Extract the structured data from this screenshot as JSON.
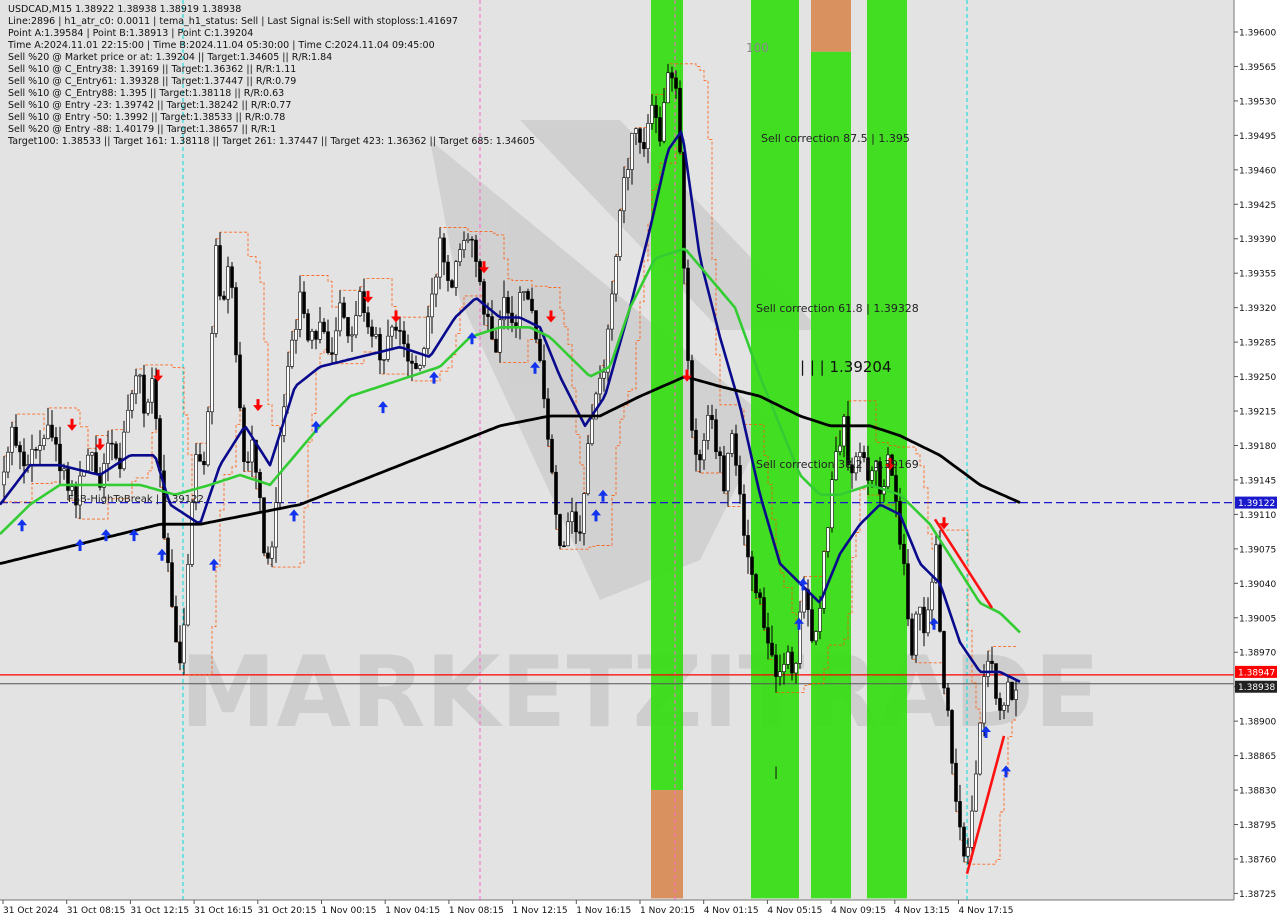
{
  "header": {
    "title": "USDCAD,M15  1.38922 1.38938 1.38919 1.38938",
    "lines": [
      "Line:2896 | h1_atr_c0: 0.0011 | tema_h1_status: Sell | Last Signal is:Sell with stoploss:1.41697",
      "Point A:1.39584 | Point B:1.38913 | Point C:1.39204",
      "Time A:2024.11.01 22:15:00 | Time B:2024.11.04 05:30:00 | Time C:2024.11.04 09:45:00",
      "Sell %20 @ Market price or at: 1.39204 || Target:1.34605 || R/R:1.84",
      "Sell %10 @ C_Entry38: 1.39169 || Target:1.36362 || R/R:1.11",
      "Sell %10 @ C_Entry61: 1.39328 || Target:1.37447 || R/R:0.79",
      "Sell %10 @ C_Entry88: 1.395 || Target:1.38118 || R/R:0.63",
      "Sell %10 @ Entry -23: 1.39742 || Target:1.38242 || R/R:0.77",
      "Sell %10 @ Entry -50: 1.3992 || Target:1.38533 || R/R:0.78",
      "Sell %20 @ Entry -88: 1.40179 || Target:1.38657 || R/R:1",
      "Target100: 1.38533 || Target 161: 1.38118 || Target 261: 1.37447 || Target 423: 1.36362 || Target 685: 1.34605"
    ]
  },
  "watermark": "MARKETZITRADE",
  "annotations": {
    "sell_correction_875": "Sell correction 87.5 | 1.395",
    "sell_correction_618": "Sell correction 61.8 | 1.39328",
    "sell_correction_382": "Sell correction 38.2 | 1.39169",
    "point_c_label": "| | | 1.39204",
    "fsb_label": "FSB-HighToBreak | 1.39122",
    "label_100": "100",
    "tick_mark": "|"
  },
  "colors": {
    "background": "#ffffff",
    "plot_bg": "#e3e3e3",
    "candle": "#000000",
    "green_zone": "#33dd11",
    "orange_zone": "#d88a55",
    "ema_navy": "#0a0a8c",
    "ema_green": "#33cc33",
    "ema_black": "#000000",
    "fsb_line": "#1a1acc",
    "bid_line": "#ff0000",
    "ask_line": "#555555",
    "sell_arrow": "#ff0000",
    "buy_arrow": "#1133ee",
    "vline_cyan": "#00dddd",
    "vline_magenta": "#ff66cc",
    "price_box_blue": "#1a1acc",
    "price_box_red": "#ff0000",
    "price_box_gray": "#222222"
  },
  "chart_data": {
    "type": "candlestick",
    "symbol": "USDCAD",
    "timeframe": "M15",
    "ylim": [
      1.3872,
      1.3969
    ],
    "y_ticks": [
      "1.39600",
      "1.39565",
      "1.39530",
      "1.39495",
      "1.39460",
      "1.39425",
      "1.39390",
      "1.39355",
      "1.39320",
      "1.39285",
      "1.39250",
      "1.39215",
      "1.39180",
      "1.39145",
      "1.39110",
      "1.39075",
      "1.39040",
      "1.39005",
      "1.38970",
      "1.38935",
      "1.38900",
      "1.38865",
      "1.38830",
      "1.38795",
      "1.38760",
      "1.38725"
    ],
    "x_ticks": [
      "31 Oct 2024",
      "31 Oct 08:15",
      "31 Oct 12:15",
      "31 Oct 16:15",
      "31 Oct 20:15",
      "1 Nov 00:15",
      "1 Nov 04:15",
      "1 Nov 08:15",
      "1 Nov 12:15",
      "1 Nov 16:15",
      "1 Nov 20:15",
      "4 Nov 01:15",
      "4 Nov 05:15",
      "4 Nov 09:15",
      "4 Nov 13:15",
      "4 Nov 17:15"
    ],
    "price_lines": [
      {
        "name": "FSB-HighToBreak",
        "value": 1.39122,
        "label": "1.39122"
      },
      {
        "name": "bid",
        "value": 1.38947,
        "label": "1.38947"
      },
      {
        "name": "last",
        "value": 1.38938,
        "label": "1.38938"
      }
    ],
    "close_path": [
      [
        0,
        1.3914
      ],
      [
        12,
        1.3919
      ],
      [
        28,
        1.3916
      ],
      [
        45,
        1.392
      ],
      [
        60,
        1.3916
      ],
      [
        75,
        1.3912
      ],
      [
        90,
        1.3918
      ],
      [
        100,
        1.3914
      ],
      [
        110,
        1.3919
      ],
      [
        120,
        1.3916
      ],
      [
        130,
        1.3923
      ],
      [
        138,
        1.3926
      ],
      [
        145,
        1.3921
      ],
      [
        152,
        1.3925
      ],
      [
        158,
        1.3917
      ],
      [
        165,
        1.3908
      ],
      [
        172,
        1.3902
      ],
      [
        180,
        1.3895
      ],
      [
        188,
        1.3905
      ],
      [
        196,
        1.3918
      ],
      [
        202,
        1.3914
      ],
      [
        210,
        1.3925
      ],
      [
        217,
        1.394
      ],
      [
        222,
        1.393
      ],
      [
        230,
        1.3938
      ],
      [
        236,
        1.3928
      ],
      [
        245,
        1.3915
      ],
      [
        252,
        1.3918
      ],
      [
        260,
        1.3912
      ],
      [
        266,
        1.3905
      ],
      [
        272,
        1.3908
      ],
      [
        280,
        1.3918
      ],
      [
        286,
        1.3925
      ],
      [
        292,
        1.3928
      ],
      [
        300,
        1.3933
      ],
      [
        308,
        1.3928
      ],
      [
        318,
        1.393
      ],
      [
        330,
        1.3927
      ],
      [
        340,
        1.3932
      ],
      [
        350,
        1.3928
      ],
      [
        360,
        1.3933
      ],
      [
        372,
        1.393
      ],
      [
        382,
        1.3926
      ],
      [
        394,
        1.3931
      ],
      [
        406,
        1.3928
      ],
      [
        418,
        1.3926
      ],
      [
        430,
        1.3931
      ],
      [
        440,
        1.3938
      ],
      [
        450,
        1.3934
      ],
      [
        460,
        1.3937
      ],
      [
        470,
        1.394
      ],
      [
        478,
        1.3936
      ],
      [
        486,
        1.3931
      ],
      [
        495,
        1.3928
      ],
      [
        505,
        1.3933
      ],
      [
        515,
        1.393
      ],
      [
        525,
        1.3935
      ],
      [
        535,
        1.3929
      ],
      [
        542,
        1.3925
      ],
      [
        548,
        1.3919
      ],
      [
        556,
        1.3912
      ],
      [
        562,
        1.3906
      ],
      [
        570,
        1.3912
      ],
      [
        578,
        1.3908
      ],
      [
        586,
        1.3916
      ],
      [
        594,
        1.3922
      ],
      [
        600,
        1.3924
      ],
      [
        608,
        1.3929
      ],
      [
        614,
        1.3934
      ],
      [
        620,
        1.3942
      ],
      [
        628,
        1.3947
      ],
      [
        636,
        1.3951
      ],
      [
        644,
        1.3948
      ],
      [
        652,
        1.3952
      ],
      [
        660,
        1.395
      ],
      [
        668,
        1.3955
      ],
      [
        674,
        1.3956
      ],
      [
        680,
        1.3948
      ],
      [
        686,
        1.393
      ],
      [
        692,
        1.392
      ],
      [
        700,
        1.3916
      ],
      [
        708,
        1.3922
      ],
      [
        716,
        1.3918
      ],
      [
        724,
        1.3914
      ],
      [
        732,
        1.3919
      ],
      [
        740,
        1.3912
      ],
      [
        748,
        1.3906
      ],
      [
        756,
        1.3904
      ],
      [
        764,
        1.39
      ],
      [
        772,
        1.3896
      ],
      [
        778,
        1.3893
      ],
      [
        786,
        1.3898
      ],
      [
        794,
        1.3894
      ],
      [
        800,
        1.39
      ],
      [
        806,
        1.3904
      ],
      [
        812,
        1.3898
      ],
      [
        820,
        1.3902
      ],
      [
        826,
        1.3909
      ],
      [
        832,
        1.3914
      ],
      [
        838,
        1.3918
      ],
      [
        844,
        1.3921
      ],
      [
        850,
        1.3913
      ],
      [
        858,
        1.3918
      ],
      [
        866,
        1.3915
      ],
      [
        874,
        1.3917
      ],
      [
        882,
        1.3913
      ],
      [
        890,
        1.3918
      ],
      [
        896,
        1.3912
      ],
      [
        904,
        1.3906
      ],
      [
        912,
        1.3896
      ],
      [
        918,
        1.3904
      ],
      [
        924,
        1.3898
      ],
      [
        930,
        1.3902
      ],
      [
        936,
        1.3908
      ],
      [
        942,
        1.3896
      ],
      [
        948,
        1.389
      ],
      [
        954,
        1.3882
      ],
      [
        960,
        1.3879
      ],
      [
        966,
        1.3876
      ],
      [
        972,
        1.388
      ],
      [
        978,
        1.3888
      ],
      [
        984,
        1.3895
      ],
      [
        990,
        1.3897
      ],
      [
        996,
        1.3893
      ],
      [
        1002,
        1.389
      ],
      [
        1008,
        1.3894
      ],
      [
        1014,
        1.3892
      ],
      [
        1020,
        1.38938
      ]
    ],
    "series": [
      {
        "name": "ema_navy",
        "color": "#0a0a8c",
        "width": 2.6,
        "points": [
          [
            0,
            1.3912
          ],
          [
            30,
            1.3916
          ],
          [
            60,
            1.3916
          ],
          [
            100,
            1.3915
          ],
          [
            130,
            1.3917
          ],
          [
            155,
            1.3917
          ],
          [
            170,
            1.3912
          ],
          [
            200,
            1.391
          ],
          [
            220,
            1.3916
          ],
          [
            245,
            1.392
          ],
          [
            270,
            1.3916
          ],
          [
            295,
            1.3924
          ],
          [
            320,
            1.3926
          ],
          [
            360,
            1.3927
          ],
          [
            400,
            1.3928
          ],
          [
            430,
            1.3927
          ],
          [
            455,
            1.3931
          ],
          [
            476,
            1.3933
          ],
          [
            500,
            1.3931
          ],
          [
            520,
            1.3931
          ],
          [
            540,
            1.393
          ],
          [
            560,
            1.3925
          ],
          [
            585,
            1.392
          ],
          [
            605,
            1.3923
          ],
          [
            630,
            1.3932
          ],
          [
            650,
            1.394
          ],
          [
            668,
            1.3948
          ],
          [
            682,
            1.395
          ],
          [
            700,
            1.3937
          ],
          [
            720,
            1.3929
          ],
          [
            740,
            1.3922
          ],
          [
            760,
            1.3913
          ],
          [
            780,
            1.3906
          ],
          [
            800,
            1.3904
          ],
          [
            820,
            1.3902
          ],
          [
            840,
            1.3907
          ],
          [
            860,
            1.391
          ],
          [
            880,
            1.3912
          ],
          [
            900,
            1.3911
          ],
          [
            920,
            1.3906
          ],
          [
            940,
            1.3904
          ],
          [
            960,
            1.3898
          ],
          [
            980,
            1.3895
          ],
          [
            1000,
            1.3895
          ],
          [
            1020,
            1.3894
          ]
        ]
      },
      {
        "name": "ema_green",
        "color": "#33cc33",
        "width": 2.6,
        "points": [
          [
            0,
            1.3909
          ],
          [
            30,
            1.3912
          ],
          [
            60,
            1.3914
          ],
          [
            100,
            1.3914
          ],
          [
            140,
            1.3914
          ],
          [
            175,
            1.3913
          ],
          [
            210,
            1.3914
          ],
          [
            240,
            1.3915
          ],
          [
            270,
            1.3914
          ],
          [
            295,
            1.3917
          ],
          [
            320,
            1.392
          ],
          [
            350,
            1.3923
          ],
          [
            380,
            1.3924
          ],
          [
            410,
            1.3925
          ],
          [
            440,
            1.3926
          ],
          [
            470,
            1.3929
          ],
          [
            500,
            1.393
          ],
          [
            530,
            1.393
          ],
          [
            550,
            1.3929
          ],
          [
            570,
            1.3927
          ],
          [
            590,
            1.3925
          ],
          [
            610,
            1.3926
          ],
          [
            630,
            1.3932
          ],
          [
            655,
            1.3937
          ],
          [
            685,
            1.3938
          ],
          [
            710,
            1.3935
          ],
          [
            735,
            1.3932
          ],
          [
            760,
            1.3925
          ],
          [
            780,
            1.392
          ],
          [
            800,
            1.3915
          ],
          [
            820,
            1.3913
          ],
          [
            840,
            1.3913
          ],
          [
            870,
            1.3914
          ],
          [
            900,
            1.3913
          ],
          [
            930,
            1.391
          ],
          [
            955,
            1.3906
          ],
          [
            980,
            1.3902
          ],
          [
            1000,
            1.3901
          ],
          [
            1020,
            1.3899
          ]
        ]
      },
      {
        "name": "ema_black",
        "color": "#000000",
        "width": 2.8,
        "points": [
          [
            0,
            1.3906
          ],
          [
            40,
            1.3907
          ],
          [
            80,
            1.3908
          ],
          [
            120,
            1.3909
          ],
          [
            160,
            1.391
          ],
          [
            200,
            1.391
          ],
          [
            250,
            1.3911
          ],
          [
            300,
            1.3912
          ],
          [
            350,
            1.3914
          ],
          [
            400,
            1.3916
          ],
          [
            450,
            1.3918
          ],
          [
            500,
            1.392
          ],
          [
            550,
            1.3921
          ],
          [
            600,
            1.3921
          ],
          [
            640,
            1.3923
          ],
          [
            685,
            1.3925
          ],
          [
            720,
            1.3924
          ],
          [
            760,
            1.3923
          ],
          [
            800,
            1.3921
          ],
          [
            830,
            1.392
          ],
          [
            870,
            1.392
          ],
          [
            900,
            1.3919
          ],
          [
            940,
            1.3917
          ],
          [
            980,
            1.3914
          ],
          [
            1020,
            1.39122
          ]
        ]
      }
    ],
    "zones": [
      {
        "color": "green",
        "x0": 651,
        "x1": 683,
        "p0": 1.3883,
        "p1": 1.3964
      },
      {
        "color": "orange",
        "x0": 651,
        "x1": 683,
        "p0": 1.3872,
        "p1": 1.3883
      },
      {
        "color": "green",
        "x0": 751,
        "x1": 799,
        "p0": 1.3872,
        "p1": 1.3969
      },
      {
        "color": "green",
        "x0": 811,
        "x1": 851,
        "p0": 1.3872,
        "p1": 1.3958
      },
      {
        "color": "orange",
        "x0": 811,
        "x1": 851,
        "p0": 1.3958,
        "p1": 1.3969
      },
      {
        "color": "green",
        "x0": 867,
        "x1": 907,
        "p0": 1.3872,
        "p1": 1.3969
      }
    ],
    "vlines": [
      {
        "x": 183,
        "color": "cyan"
      },
      {
        "x": 480,
        "color": "magenta"
      },
      {
        "x": 675,
        "color": "magenta"
      },
      {
        "x": 967,
        "color": "cyan"
      }
    ],
    "sell_arrows": [
      [
        72,
        1.392
      ],
      [
        100,
        1.3918
      ],
      [
        158,
        1.3925
      ],
      [
        258,
        1.3922
      ],
      [
        368,
        1.3933
      ],
      [
        396,
        1.3931
      ],
      [
        484,
        1.3936
      ],
      [
        551,
        1.3931
      ],
      [
        687,
        1.3925
      ],
      [
        890,
        1.3916
      ],
      [
        944,
        1.391
      ]
    ],
    "buy_arrows": [
      [
        22,
        1.391
      ],
      [
        80,
        1.3908
      ],
      [
        106,
        1.3909
      ],
      [
        134,
        1.3909
      ],
      [
        162,
        1.3907
      ],
      [
        214,
        1.3906
      ],
      [
        294,
        1.3911
      ],
      [
        316,
        1.392
      ],
      [
        383,
        1.3922
      ],
      [
        434,
        1.3925
      ],
      [
        472,
        1.3929
      ],
      [
        535,
        1.3926
      ],
      [
        596,
        1.3911
      ],
      [
        603,
        1.3913
      ],
      [
        799,
        1.39
      ],
      [
        803,
        1.3904
      ],
      [
        934,
        1.39
      ],
      [
        986,
        1.3889
      ],
      [
        1006,
        1.3885
      ]
    ],
    "red_lines": [
      [
        [
          935,
          1.39105
        ],
        [
          992,
          1.39015
        ]
      ],
      [
        [
          967,
          1.38745
        ],
        [
          1004,
          1.38885
        ]
      ]
    ]
  }
}
